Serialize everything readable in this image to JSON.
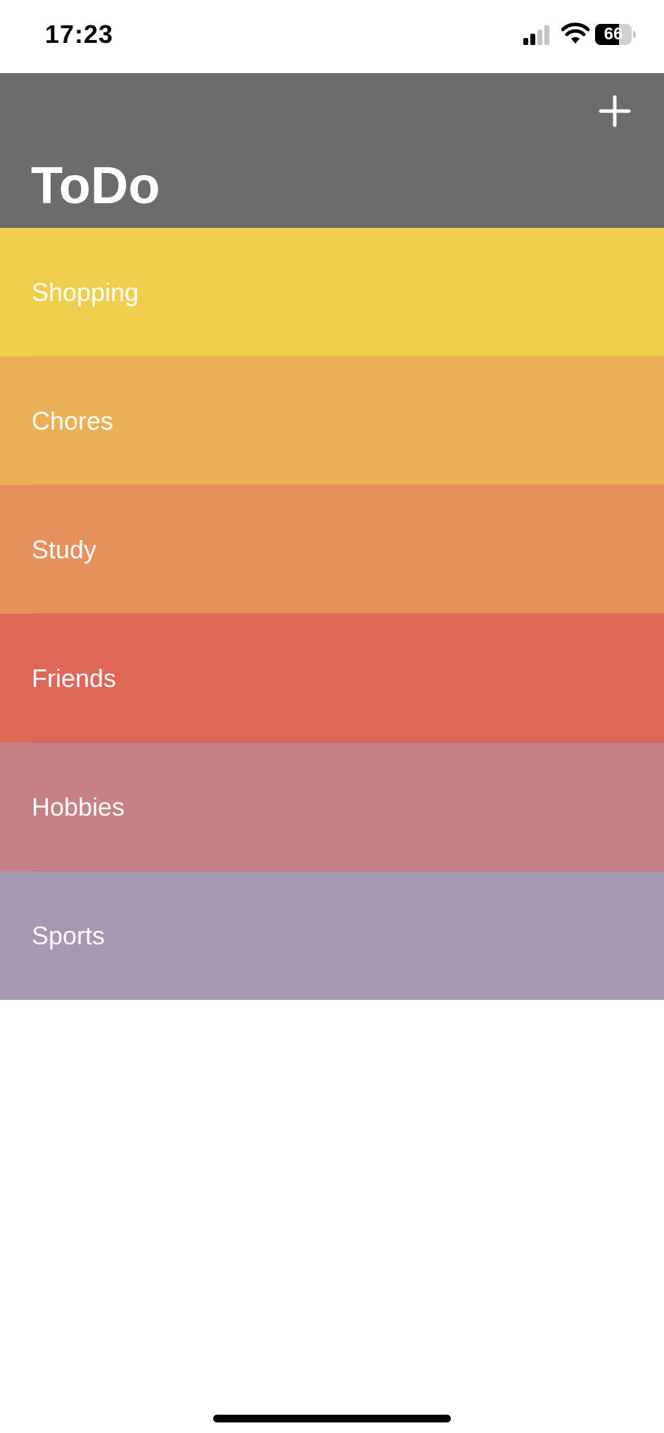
{
  "status_bar": {
    "time": "17:23",
    "battery_level": "66",
    "battery_fraction": 0.66,
    "icons": [
      "cellular-signal-icon",
      "wifi-icon",
      "battery-icon"
    ]
  },
  "header": {
    "title": "ToDo",
    "add_icon": "plus-icon",
    "background_color": "#6d6b6e"
  },
  "categories": [
    {
      "label": "Shopping",
      "color": "#f0cf4e"
    },
    {
      "label": "Chores",
      "color": "#ebb055"
    },
    {
      "label": "Study",
      "color": "#e6905b"
    },
    {
      "label": "Friends",
      "color": "#df6757"
    },
    {
      "label": "Hobbies",
      "color": "#c78184"
    },
    {
      "label": "Sports",
      "color": "#a897b3"
    }
  ]
}
